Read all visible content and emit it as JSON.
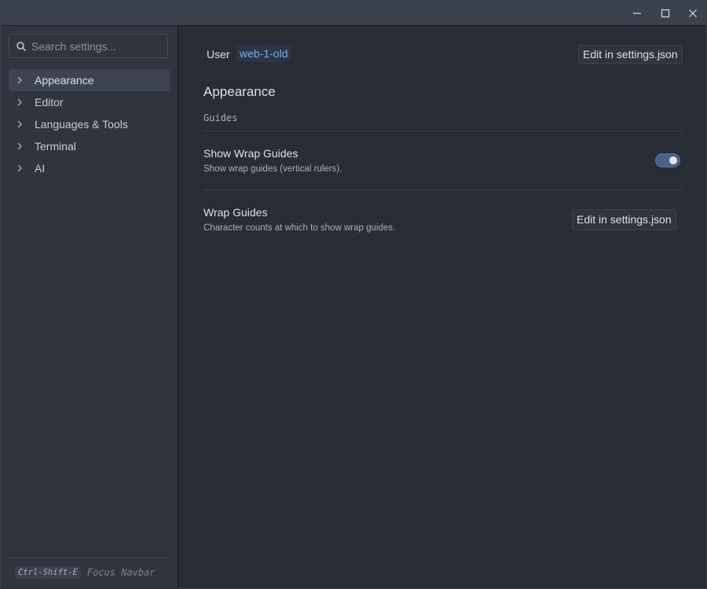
{
  "window": {
    "controls": [
      {
        "name": "minimize-icon"
      },
      {
        "name": "maximize-icon"
      },
      {
        "name": "close-icon"
      }
    ]
  },
  "sidebar": {
    "search": {
      "placeholder": "Search settings...",
      "value": "",
      "icon": "search-icon"
    },
    "items": [
      {
        "label": "Appearance",
        "active": true,
        "icon": "chevron-right-icon"
      },
      {
        "label": "Editor",
        "active": false,
        "icon": "chevron-right-icon"
      },
      {
        "label": "Languages & Tools",
        "active": false,
        "icon": "chevron-right-icon"
      },
      {
        "label": "Terminal",
        "active": false,
        "icon": "chevron-right-icon"
      },
      {
        "label": "AI",
        "active": false,
        "icon": "chevron-right-icon"
      }
    ],
    "footer": {
      "shortcut": "Ctrl-Shift-E",
      "label": "Focus Navbar"
    }
  },
  "main": {
    "scope": {
      "user_label": "User",
      "project_tag": "web-1-old",
      "edit_button": "Edit in settings.json"
    },
    "section_title": "Appearance",
    "group_label": "Guides",
    "settings": [
      {
        "title": "Show Wrap Guides",
        "description": "Show wrap guides (vertical rulers).",
        "control": "toggle",
        "enabled": true
      },
      {
        "title": "Wrap Guides",
        "description": "Character counts at which to show wrap guides.",
        "control": "button",
        "button_label": "Edit in settings.json"
      }
    ]
  },
  "colors": {
    "background": "#282c34",
    "sidebar": "#2f343f",
    "accent": "#74ade8",
    "toggle_on": "#4b6187"
  }
}
